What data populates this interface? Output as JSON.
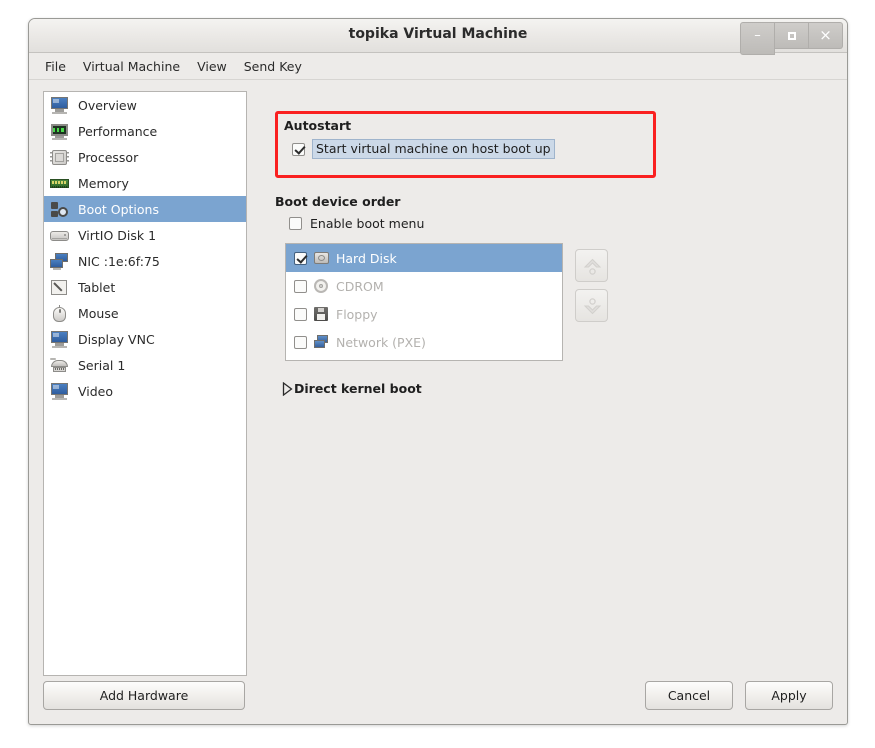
{
  "window": {
    "title": "topika Virtual Machine",
    "controls": [
      {
        "name": "minimize",
        "glyph": "–"
      },
      {
        "name": "maximize",
        "glyph": ""
      },
      {
        "name": "close",
        "glyph": "×"
      }
    ]
  },
  "menubar": {
    "items": [
      {
        "label": "File"
      },
      {
        "label": "Virtual Machine"
      },
      {
        "label": "View"
      },
      {
        "label": "Send Key"
      }
    ]
  },
  "sidebar": {
    "items": [
      {
        "label": "Overview",
        "icon": "monitor-icon",
        "selected": false
      },
      {
        "label": "Performance",
        "icon": "performance-icon",
        "selected": false
      },
      {
        "label": "Processor",
        "icon": "cpu-icon",
        "selected": false
      },
      {
        "label": "Memory",
        "icon": "memory-icon",
        "selected": false
      },
      {
        "label": "Boot Options",
        "icon": "boot-options-icon",
        "selected": true
      },
      {
        "label": "VirtIO Disk 1",
        "icon": "disk-icon",
        "selected": false
      },
      {
        "label": "NIC :1e:6f:75",
        "icon": "nic-icon",
        "selected": false
      },
      {
        "label": "Tablet",
        "icon": "tablet-icon",
        "selected": false
      },
      {
        "label": "Mouse",
        "icon": "mouse-icon",
        "selected": false
      },
      {
        "label": "Display VNC",
        "icon": "display-icon",
        "selected": false
      },
      {
        "label": "Serial 1",
        "icon": "serial-icon",
        "selected": false
      },
      {
        "label": "Video",
        "icon": "video-icon",
        "selected": false
      }
    ]
  },
  "autostart": {
    "section_title": "Autostart",
    "checkbox_label": "Start virtual machine on host boot up",
    "checked": true,
    "highlight_color": "#fa2020",
    "focus_background": "#ccd9e8"
  },
  "boot": {
    "section_title": "Boot device order",
    "enable_boot_menu_label": "Enable boot menu",
    "enable_boot_menu_checked": false,
    "devices": [
      {
        "label": "Hard Disk",
        "icon": "hard-disk-icon",
        "checked": true,
        "selected": true,
        "enabled": true
      },
      {
        "label": "CDROM",
        "icon": "cdrom-icon",
        "checked": false,
        "selected": false,
        "enabled": false
      },
      {
        "label": "Floppy",
        "icon": "floppy-icon",
        "checked": false,
        "selected": false,
        "enabled": false
      },
      {
        "label": "Network (PXE)",
        "icon": "network-icon",
        "checked": false,
        "selected": false,
        "enabled": false
      }
    ],
    "move_up_label": "Move device up",
    "move_down_label": "Move device down",
    "selection_color": "#7ba4d0"
  },
  "direct_kernel_boot": {
    "label": "Direct kernel boot",
    "expanded": false
  },
  "footer": {
    "add_hardware_label": "Add Hardware",
    "cancel_label": "Cancel",
    "apply_label": "Apply"
  }
}
